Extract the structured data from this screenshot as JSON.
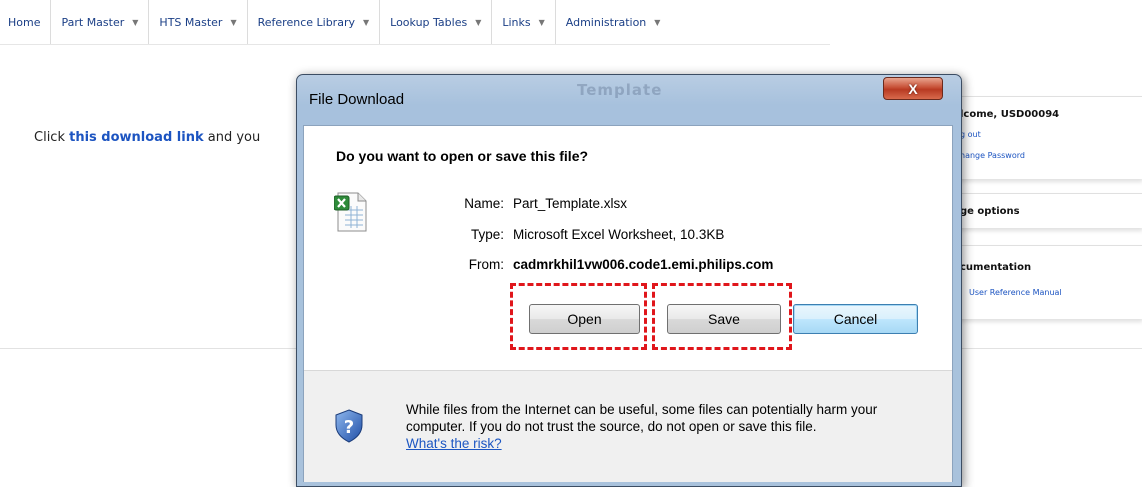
{
  "nav": {
    "items": [
      {
        "label": "Home",
        "has_caret": false
      },
      {
        "label": "Part Master",
        "has_caret": true
      },
      {
        "label": "HTS Master",
        "has_caret": true
      },
      {
        "label": "Reference Library",
        "has_caret": true
      },
      {
        "label": "Lookup Tables",
        "has_caret": true
      },
      {
        "label": "Links",
        "has_caret": true
      },
      {
        "label": "Administration",
        "has_caret": true
      }
    ],
    "caret_glyph": "▼"
  },
  "page": {
    "text_before": "Click ",
    "link_text": "this download link",
    "text_after": " and you"
  },
  "side": {
    "welcome_title": "lcome, USD00094",
    "logout": "g out",
    "change_password": "hange Password",
    "page_options_title": "ge options",
    "documentation_title": "cumentation",
    "manual_link": "User Reference Manual"
  },
  "dialog": {
    "ghost_title": "Template",
    "title": "File Download",
    "close_label": "X",
    "question": "Do you want to open or save this file?",
    "name_label": "Name:",
    "name_value": "Part_Template.xlsx",
    "type_label": "Type:",
    "type_value": "Microsoft Excel Worksheet, 10.3KB",
    "from_label": "From:",
    "from_value": "cadmrkhil1vw006.code1.emi.philips.com",
    "open_label": "Open",
    "save_label": "Save",
    "cancel_label": "Cancel",
    "warning_text": "While files from the Internet can be useful, some files can potentially harm your computer. If you do not trust the source, do not open or save this file.",
    "warning_link": "What's the risk?"
  },
  "colors": {
    "highlight_dash": "#e0161b",
    "link": "#1c54c1",
    "nav_text": "#1b3f86"
  }
}
